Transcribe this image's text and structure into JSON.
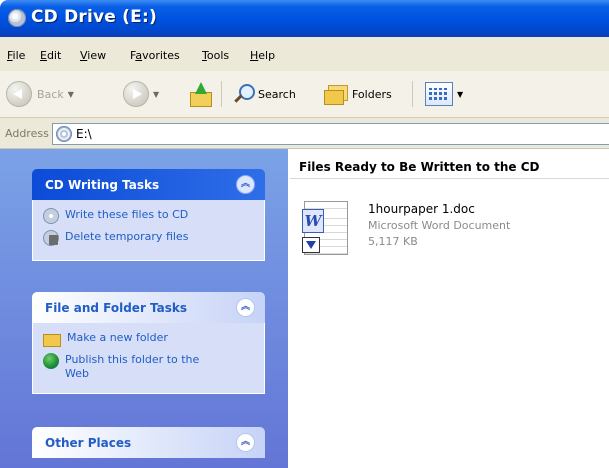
{
  "window": {
    "title": "CD Drive (E:)"
  },
  "menu": [
    "File",
    "Edit",
    "View",
    "Favorites",
    "Tools",
    "Help"
  ],
  "menu_underline": [
    "F",
    "E",
    "V",
    "a",
    "T",
    "H"
  ],
  "toolbar": {
    "back_label": "Back",
    "search_label": "Search",
    "folders_label": "Folders"
  },
  "address": {
    "label": "Address",
    "value": "E:\\"
  },
  "sidebar": {
    "cd_tasks": {
      "title": "CD Writing Tasks",
      "items": [
        "Write these files to CD",
        "Delete temporary files"
      ]
    },
    "file_tasks": {
      "title": "File and Folder Tasks",
      "items": [
        "Make a new folder",
        "Publish this folder to the Web"
      ]
    },
    "other_places": {
      "title": "Other Places"
    }
  },
  "content": {
    "title": "Files Ready to Be Written to the CD",
    "file": {
      "name": "1hourpaper 1.doc",
      "type": "Microsoft Word Document",
      "size": "5,117 KB"
    }
  },
  "colors": {
    "titlebar": "#0054e3",
    "sidebar_link": "#215dc6",
    "menu_bg": "#ece9d8"
  }
}
